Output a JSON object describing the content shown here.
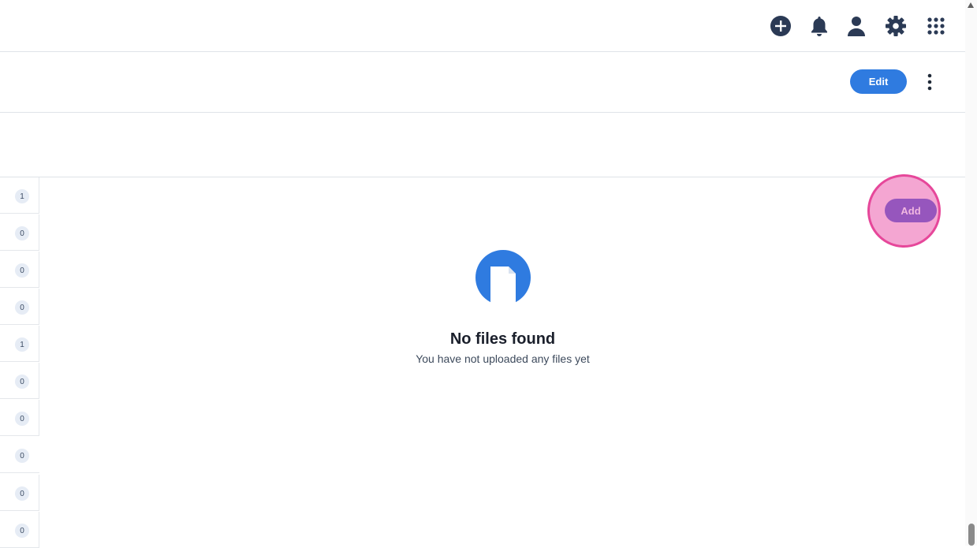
{
  "header": {
    "icons": [
      "add-circle-icon",
      "bell-icon",
      "user-icon",
      "gear-icon",
      "apps-grid-icon"
    ]
  },
  "toolbar": {
    "edit_label": "Edit",
    "more_icon": "kebab-menu-icon"
  },
  "left_list": {
    "counts": [
      "1",
      "0",
      "0",
      "0",
      "1",
      "0",
      "0",
      "0",
      "0",
      "0"
    ]
  },
  "empty_state": {
    "icon": "file-icon",
    "title": "No files found",
    "subtitle": "You have not uploaded any files yet"
  },
  "actions": {
    "add_label": "Add"
  },
  "colors": {
    "primary": "#2f7be0",
    "icon_dark": "#2b3a55",
    "add_button": "#9656bd",
    "highlight": "#f4a6d2",
    "highlight_border": "#e6479a"
  }
}
